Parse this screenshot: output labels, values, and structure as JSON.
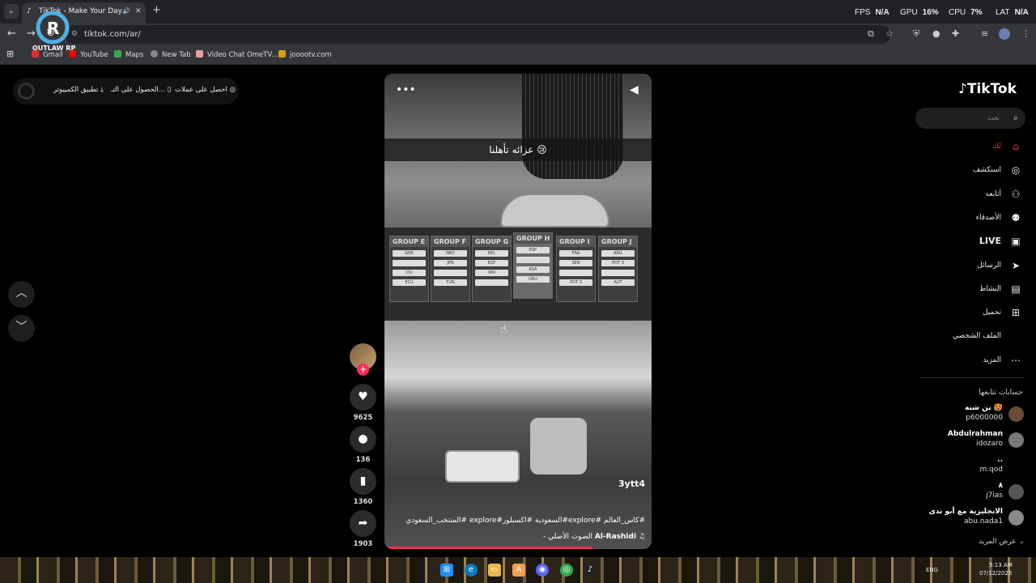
{
  "browser": {
    "tab_title": "TikTok - Make Your Day",
    "url": "tiktok.com/ar/",
    "new_tab_symbol": "+",
    "bookmarks": [
      "Gmail",
      "YouTube",
      "Maps",
      "New Tab",
      "Video Chat OmeTV...",
      "jooootv.com"
    ]
  },
  "overlay": {
    "fps_label": "FPS",
    "fps_value": "N/A",
    "gpu_label": "GPU",
    "gpu_value": "16%",
    "cpu_label": "CPU",
    "cpu_value": "7%",
    "lat_label": "LAT",
    "lat_value": "N/A",
    "logo_text": "OUTLAW RP"
  },
  "topbar": {
    "get_coins": "احصل على عملات",
    "get_app": "الحصول على التـ...",
    "desktop_app": "تطبيق الكمبيوتر"
  },
  "video": {
    "caption": "عزائه تأهلنا 😢",
    "handle": "3ytt4",
    "description": "#كاس_العالم #explore#السعودية #اكسبلور#explore #المنتخب_السعودي",
    "music_artist": "Al-Rashidi",
    "music_title": "الصوت الأصلي -",
    "music_icon": "♫",
    "progress": 0.78,
    "groups": [
      {
        "label": "GROUP E",
        "teams": [
          "GER",
          "",
          "CIV",
          "ECU"
        ]
      },
      {
        "label": "GROUP F",
        "teams": [
          "NED",
          "JPN",
          "",
          "TUN"
        ]
      },
      {
        "label": "GROUP G",
        "teams": [
          "BEL",
          "EGY",
          "IRN",
          ""
        ]
      },
      {
        "label": "GROUP H",
        "teams": [
          "ESP",
          "",
          "KSA",
          "URU"
        ]
      },
      {
        "label": "GROUP I",
        "teams": [
          "FRA",
          "SEN",
          "",
          "POT 3"
        ]
      },
      {
        "label": "GROUP J",
        "teams": [
          "ARG",
          "POT 3",
          "",
          "AUT"
        ]
      }
    ]
  },
  "actions": {
    "likes": "9625",
    "comments": "136",
    "saves": "1360",
    "shares": "1903"
  },
  "sidebar": {
    "logo": "TikTok",
    "search_placeholder": "بحث",
    "nav": [
      {
        "label": "لك",
        "icon": "home-icon"
      },
      {
        "label": "استكشف",
        "icon": "compass-icon"
      },
      {
        "label": "أتابعه",
        "icon": "user-follow-icon"
      },
      {
        "label": "الأصدقاء",
        "icon": "friends-icon"
      },
      {
        "label": "LIVE",
        "icon": "live-icon"
      },
      {
        "label": "الرسائل",
        "icon": "send-icon"
      },
      {
        "label": "النشاط",
        "icon": "activity-icon"
      },
      {
        "label": "تحميل",
        "icon": "upload-icon"
      },
      {
        "label": "الملف الشخصي",
        "icon": "profile-icon"
      },
      {
        "label": "المزيد",
        "icon": "more-icon"
      }
    ],
    "following_header": "حسابات تتابعها",
    "accounts": [
      {
        "name": "بن شنة 🥵",
        "handle": "p6000000"
      },
      {
        "name": "Abdulrahman",
        "handle": "idozaro"
      },
      {
        "name": "..",
        "handle": "m.qod"
      },
      {
        "name": "٨",
        "handle": "j7ias"
      },
      {
        "name": "الانجليزية مع أبو ندى",
        "handle": "abu.nada1"
      }
    ],
    "see_more": "عرض المزيد"
  },
  "taskbar": {
    "lang": "ENG",
    "time": "5:13 AM",
    "date": "07/12/2025"
  },
  "colors": {
    "accent": "#fe2c55",
    "chrome_bg": "#202124",
    "toolbar_bg": "#35363a"
  }
}
